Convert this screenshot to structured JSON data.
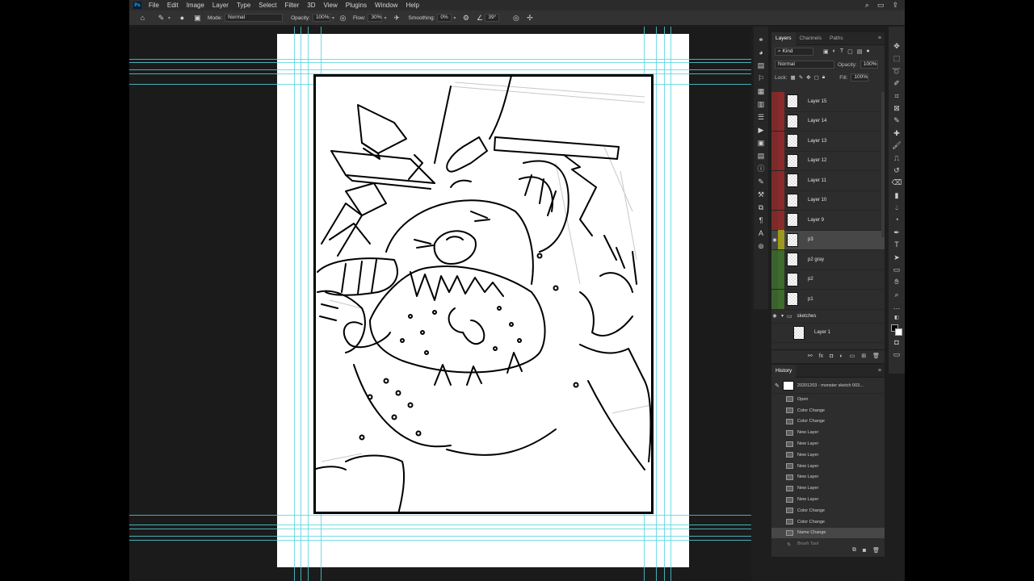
{
  "menu": {
    "logo": "Ps",
    "items": [
      "File",
      "Edit",
      "Image",
      "Layer",
      "Type",
      "Select",
      "Filter",
      "3D",
      "View",
      "Plugins",
      "Window",
      "Help"
    ]
  },
  "options": {
    "mode_label": "Mode:",
    "mode_value": "Normal",
    "opacity_label": "Opacity:",
    "opacity_value": "100%",
    "flow_label": "Flow:",
    "flow_value": "30%",
    "smoothing_label": "Smoothing:",
    "smoothing_value": "0%",
    "angle_value": "39°"
  },
  "layers_panel": {
    "tabs": [
      "Layers",
      "Channels",
      "Paths"
    ],
    "filter_kind": "Kind",
    "blend_mode": "Normal",
    "opacity_label": "Opacity:",
    "opacity_value": "100%",
    "lock_label": "Lock:",
    "fill_label": "Fill:",
    "fill_value": "100%",
    "layers": [
      {
        "name": "Layer 15",
        "color": "#8b2a2a",
        "visible": false,
        "selected": false
      },
      {
        "name": "Layer 14",
        "color": "#8b2a2a",
        "visible": false,
        "selected": false
      },
      {
        "name": "Layer 13",
        "color": "#8b2a2a",
        "visible": false,
        "selected": false
      },
      {
        "name": "Layer 12",
        "color": "#8b2a2a",
        "visible": false,
        "selected": false
      },
      {
        "name": "Layer 11",
        "color": "#8b2a2a",
        "visible": false,
        "selected": false
      },
      {
        "name": "Layer 10",
        "color": "#8b2a2a",
        "visible": false,
        "selected": false
      },
      {
        "name": "Layer 9",
        "color": "#8b2a2a",
        "visible": false,
        "selected": false
      },
      {
        "name": "p3",
        "color": "#9c9a1c",
        "visible": true,
        "selected": true
      },
      {
        "name": "p2 gray",
        "color": "#3e6b2e",
        "visible": false,
        "selected": false
      },
      {
        "name": "p2",
        "color": "#3e6b2e",
        "visible": false,
        "selected": false
      },
      {
        "name": "p1",
        "color": "#3e6b2e",
        "visible": false,
        "selected": false
      }
    ],
    "group": {
      "name": "sketches"
    },
    "group_child": {
      "name": "Layer 1"
    }
  },
  "history_panel": {
    "title": "History",
    "snapshot": "20201203 - monster sketch 003...",
    "states": [
      {
        "label": "Open",
        "selected": false
      },
      {
        "label": "Color Change",
        "selected": false
      },
      {
        "label": "Color Change",
        "selected": false
      },
      {
        "label": "New Layer",
        "selected": false
      },
      {
        "label": "New Layer",
        "selected": false
      },
      {
        "label": "New Layer",
        "selected": false
      },
      {
        "label": "New Layer",
        "selected": false
      },
      {
        "label": "New Layer",
        "selected": false
      },
      {
        "label": "New Layer",
        "selected": false
      },
      {
        "label": "New Layer",
        "selected": false
      },
      {
        "label": "Color Change",
        "selected": false
      },
      {
        "label": "Color Change",
        "selected": false
      },
      {
        "label": "Name Change",
        "selected": true
      },
      {
        "label": "Brush Tool",
        "selected": false,
        "ghost": true
      }
    ]
  },
  "colors": {
    "foreground": "#000000",
    "background": "#ffffff",
    "guide": "#52d3e0"
  }
}
